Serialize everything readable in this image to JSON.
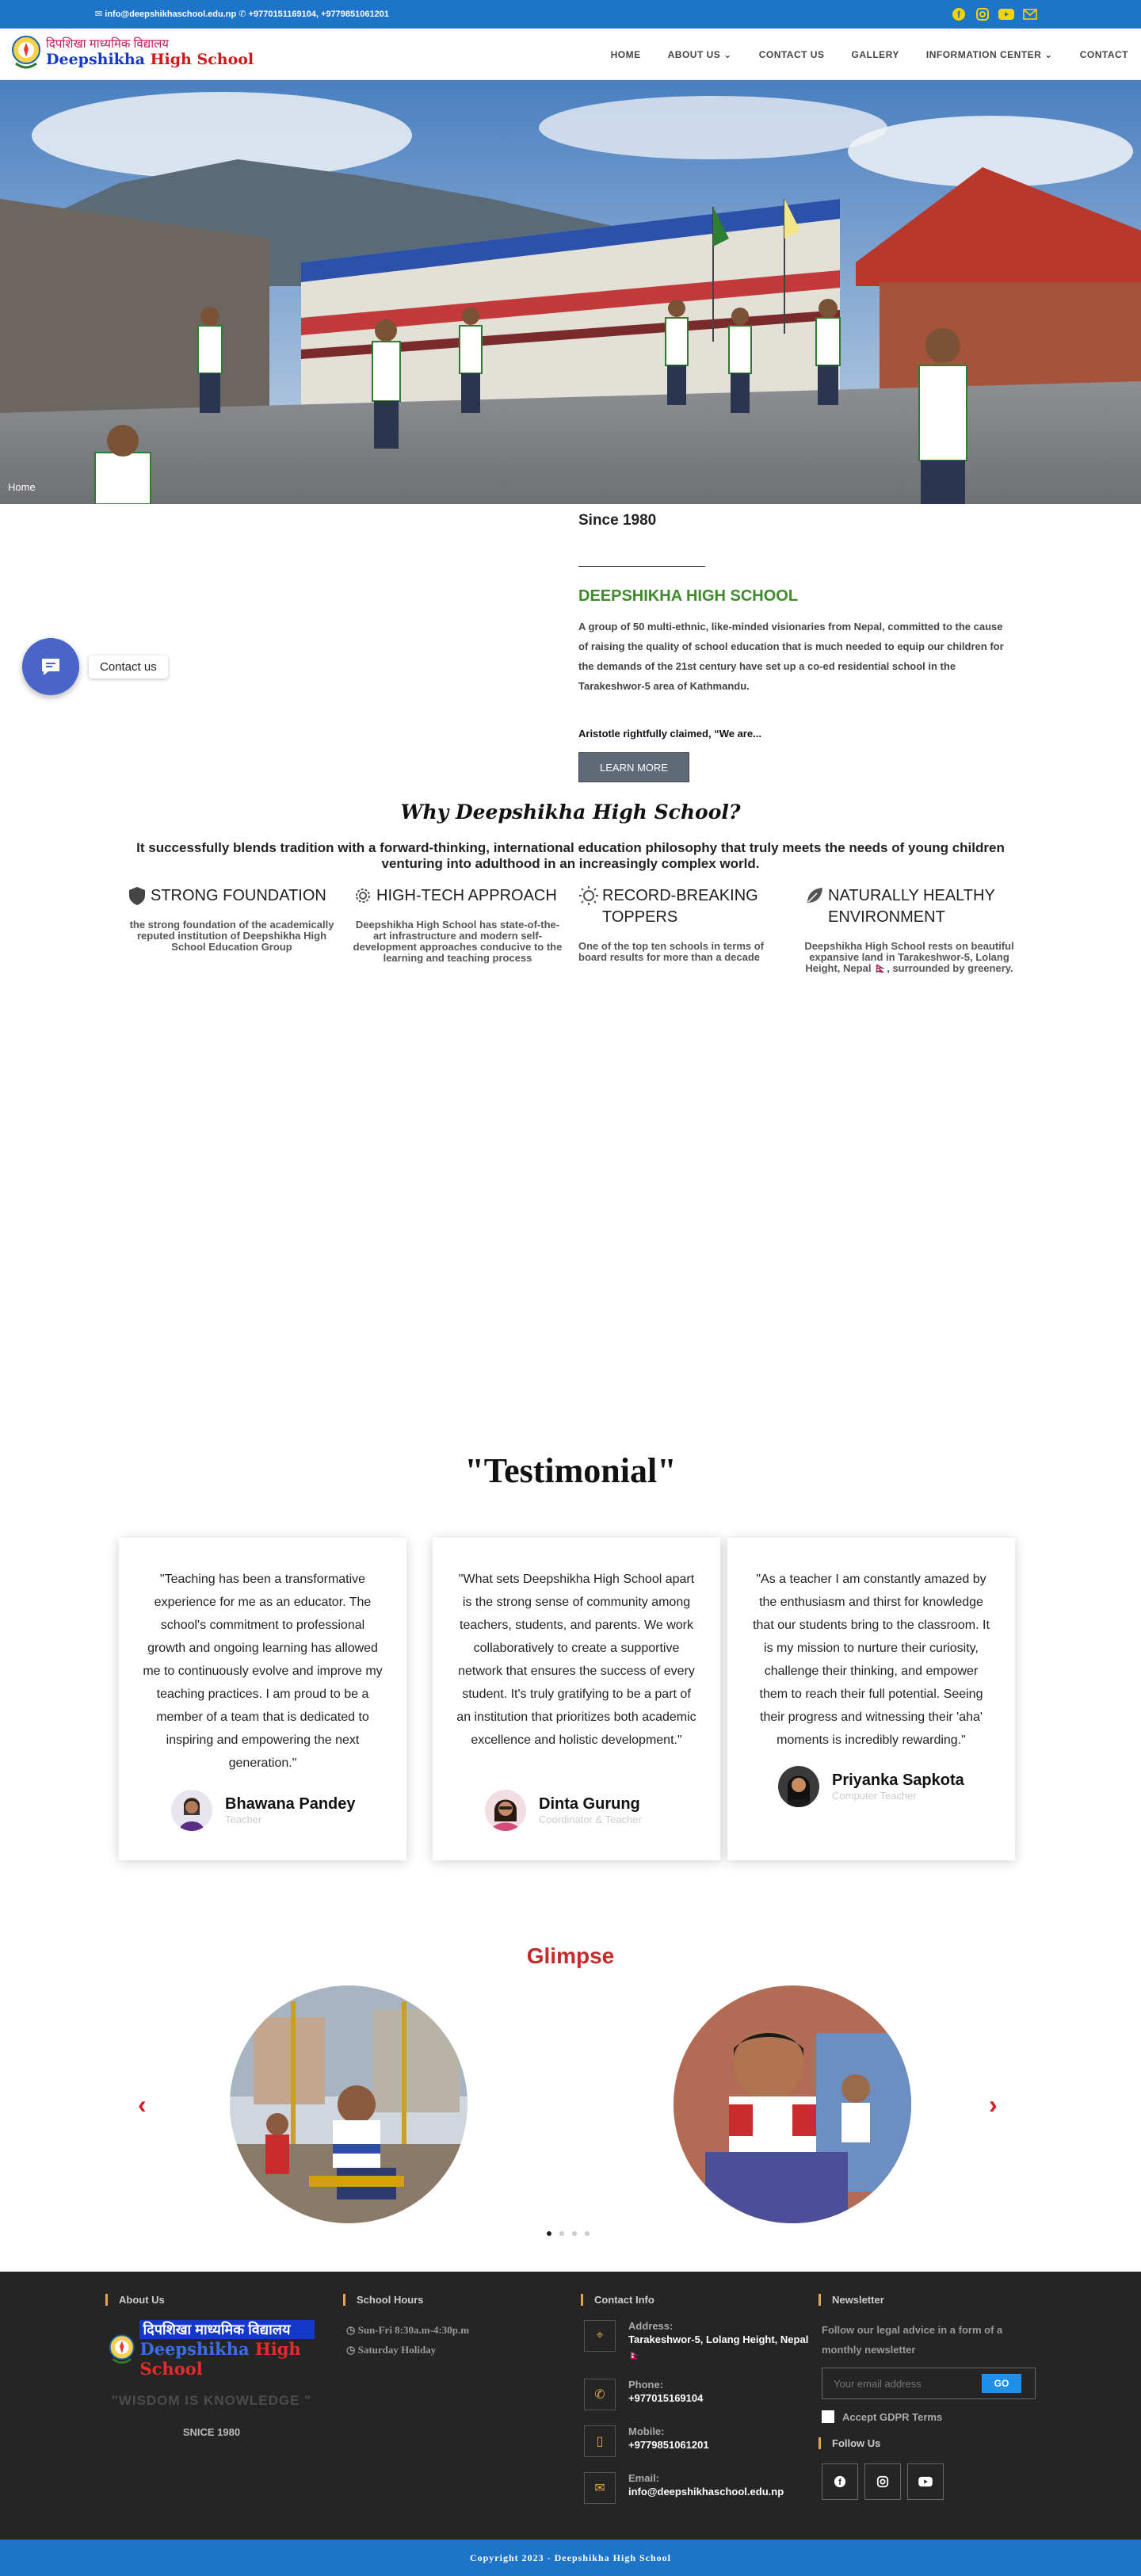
{
  "topbar": {
    "contact": "✉ info@deepshikhaschool.edu.np ✆ +9770151169104, +9779851061201",
    "social": [
      "facebook-icon",
      "instagram-icon",
      "youtube-icon",
      "mail-icon"
    ]
  },
  "logo": {
    "devanagari": "दिपशिखा माध्यमिक विद्यालय",
    "name_a": "Deepshikha",
    "name_b": "High School"
  },
  "nav": [
    "HOME",
    "ABOUT US",
    "CONTACT US",
    "GALLERY",
    "INFORMATION CENTER",
    "CONTACT"
  ],
  "hero": {
    "breadcrumb": "Home"
  },
  "about": {
    "since": "Since 1980",
    "title": "DEEPSHIKHA HIGH SCHOOL",
    "body": "A group of 50 multi-ethnic, like-minded visionaries from Nepal, committed to the cause of raising the quality of school education that is much needed to equip our children for the demands of the 21st century have set up a co-ed residential school in the Tarakeshwor-5 area of Kathmandu.",
    "quote": "Aristotle rightfully claimed, “We are...",
    "button": "LEARN MORE"
  },
  "chat": {
    "label": "Contact us"
  },
  "why": {
    "title": "Why Deepshikha High School?",
    "subtitle": "It successfully blends tradition with a forward-thinking, international education philosophy that truly meets the needs of young children venturing into adulthood in an increasingly complex world.",
    "features": [
      {
        "title": "STRONG FOUNDATION",
        "text": "the strong foundation of the academically reputed institution of Deepshikha High School Education Group",
        "icon": "shield-icon"
      },
      {
        "title": "HIGH-TECH APPROACH",
        "text": "Deepshikha High School has state-of-the-art infrastructure and modern self-development approaches conducive to the learning and teaching process",
        "icon": "gear-icon"
      },
      {
        "title": "RECORD-BREAKING TOPPERS",
        "text": "One of the top ten schools in terms of board results for more than a decade",
        "icon": "sun-icon"
      },
      {
        "title": "NATURALLY HEALTHY ENVIRONMENT",
        "text": "Deepshikha High School rests on beautiful expansive land in Tarakeshwor-5, Lolang Height, Nepal 🇳🇵, surrounded by greenery.",
        "icon": "leaf-icon"
      }
    ]
  },
  "testimonial": {
    "title": "\"Testimonial\"",
    "items": [
      {
        "text": "\"Teaching has been a transformative experience for me as an educator. The school's commitment to professional growth and ongoing learning has allowed me to continuously evolve and improve my teaching practices. I am proud to be a member of a team that is dedicated to inspiring and empowering the next generation.\"",
        "name": "Bhawana Pandey",
        "role": "Teacher"
      },
      {
        "text": "\"What sets Deepshikha High School apart is the strong sense of community among teachers, students, and parents. We work collaboratively to create a supportive network that ensures the success of every student. It's truly gratifying to be a part of an institution that prioritizes both academic excellence and holistic development.\"",
        "name": "Dinta Gurung",
        "role": "Coordinator & Teacher"
      },
      {
        "text": "\"As a teacher I am constantly amazed by the enthusiasm and thirst for knowledge that our students bring to the classroom. It is my mission to nurture their curiosity, challenge their thinking, and empower them to reach their full potential. Seeing their progress and witnessing their 'aha' moments is incredibly rewarding.\"",
        "name": "Priyanka Sapkota",
        "role": "Computer Teacher"
      }
    ]
  },
  "glimpse": {
    "title": "Glimpse",
    "prev": "‹",
    "next": "›"
  },
  "footer": {
    "about": {
      "heading": "About Us",
      "motto": "\"WISDOM IS KNOWLEDGE \"",
      "since": "SNICE 1980"
    },
    "hours": {
      "heading": "School Hours",
      "lines": [
        "Sun-Fri 8:30a.m-4:30p.m",
        "Saturday Holiday"
      ]
    },
    "contact": {
      "heading": "Contact Info",
      "items": [
        {
          "label": "Address:",
          "value": "Tarakeshwor-5, Lolang Height, Nepal 🇳🇵",
          "icon": "location-icon"
        },
        {
          "label": "Phone:",
          "value": "+977015169104",
          "icon": "phone-icon"
        },
        {
          "label": "Mobile:",
          "value": "+9779851061201",
          "icon": "mobile-icon"
        },
        {
          "label": "Email:",
          "value": "info@deepshikhaschool.edu.np",
          "icon": "mail-icon"
        }
      ]
    },
    "newsletter": {
      "heading": "Newsletter",
      "text": "Follow our legal advice in a form of a monthly newsletter",
      "placeholder": "Your email address",
      "go": "GO",
      "gdpr": "Accept GDPR Terms",
      "follow": "Follow Us"
    },
    "copyright": "Copyright 2023 - Deepshikha High School"
  },
  "colors": {
    "brand_blue": "#1e74c8",
    "accent_green": "#3e8b2c",
    "accent_red": "#c42c2c",
    "footer_bg": "#252525"
  }
}
